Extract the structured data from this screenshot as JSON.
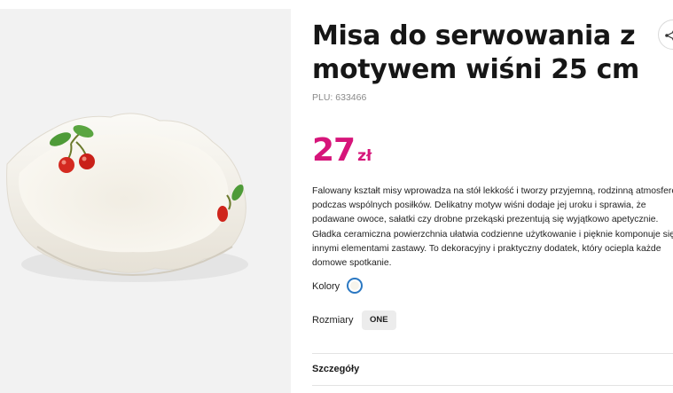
{
  "product": {
    "title": "Misa do serwowania z motywem wiśni 25 cm",
    "plu": "PLU: 633466",
    "price_value": "27",
    "price_currency": "zł",
    "description": "Falowany kształt misy wprowadza na stół lekkość i tworzy przyjemną, rodzinną atmosferę podczas wspólnych posiłków. Delikatny motyw wiśni dodaje jej uroku i sprawia, że podawane owoce, sałatki czy drobne przekąski prezentują się wyjątkowo apetycznie. Gładka ceramiczna powierzchnia ułatwia codzienne użytkowanie i pięknie komponuje się z innymi elementami zastawy. To dekoracyjny i praktyczny dodatek, który ociepla każde domowe spotkanie."
  },
  "options": {
    "colors_label": "Kolory",
    "sizes_label": "Rozmiary",
    "size_value": "ONE"
  },
  "sections": {
    "details_label": "Szczegóły"
  },
  "icons": {
    "share": "share-icon"
  },
  "colors": {
    "accent_price": "#d6157a",
    "selected_ring": "#2b78c2",
    "gallery_bg": "#f2f2f2"
  }
}
